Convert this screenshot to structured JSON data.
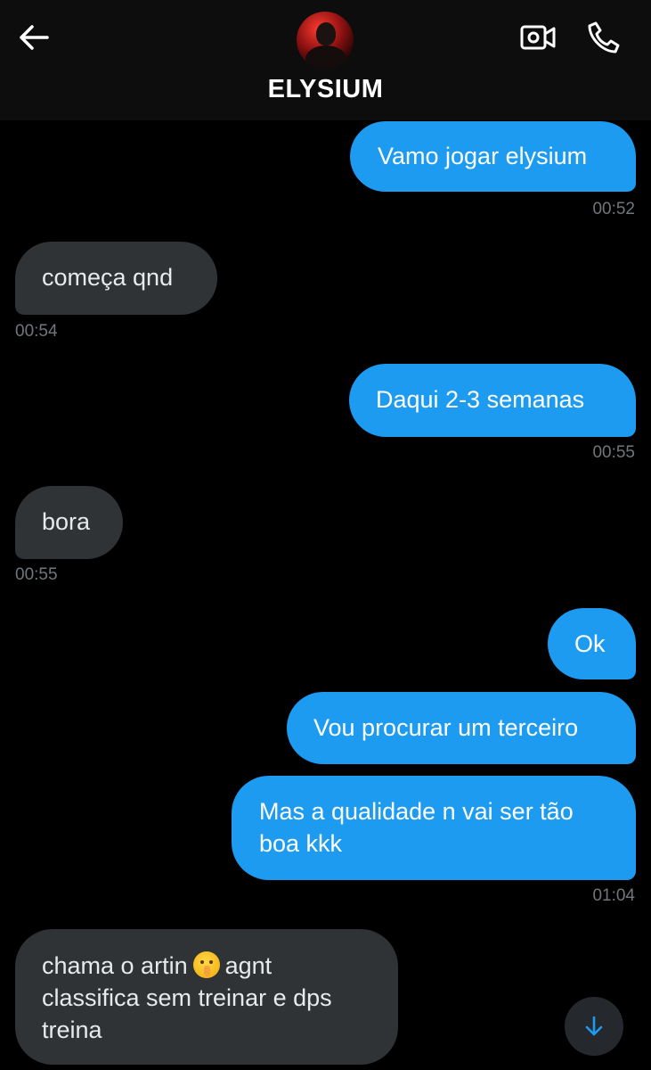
{
  "header": {
    "contact_name": "ELYSIUM",
    "back_icon": "arrow-left-icon",
    "video_icon": "video-call-icon",
    "call_icon": "phone-icon"
  },
  "messages": [
    {
      "direction": "sent",
      "text": "Vamo jogar elysium",
      "time": "00:52"
    },
    {
      "direction": "received",
      "text": "começa qnd",
      "time": "00:54"
    },
    {
      "direction": "sent",
      "text": "Daqui 2-3 semanas",
      "time": "00:55"
    },
    {
      "direction": "received",
      "text": "bora",
      "time": "00:55"
    },
    {
      "direction": "sent",
      "text": "Ok",
      "time": ""
    },
    {
      "direction": "sent",
      "text": "Vou procurar um terceiro",
      "time": ""
    },
    {
      "direction": "sent",
      "text_line1": "Mas a qualidade n vai ser tão",
      "text_line2": "boa kkk",
      "time": "01:04"
    },
    {
      "direction": "received",
      "text_before_emoji": "chama o artin",
      "emoji": "shushing-face",
      "text_after_emoji": "agnt",
      "text_line2": "classifica sem treinar e dps",
      "text_line3": "treina",
      "time": ""
    }
  ],
  "colors": {
    "sent_bubble": "#1d9bf0",
    "received_bubble": "#2f3336",
    "background": "#000000",
    "timestamp": "#71767b"
  },
  "scroll_button": {
    "icon": "arrow-down-icon"
  }
}
